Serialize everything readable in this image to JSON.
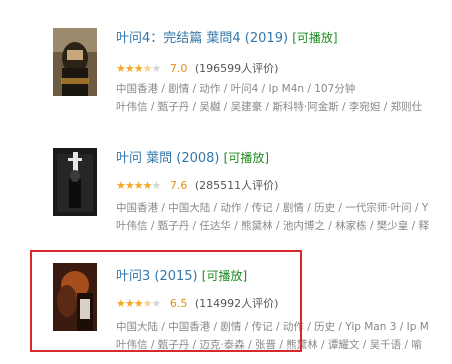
{
  "results": [
    {
      "title": "叶问4：完结篇 葉問4 (2019)",
      "playable": "[可播放]",
      "rating": 7.0,
      "rating_text": "7.0",
      "votes": "(196599人评价)",
      "meta": "中国香港 / 剧情 / 动作 / 叶问4 / Ip M4n / 107分钟",
      "cast": "叶伟信 / 甄子丹 / 吴樾 / 吴建豪 / 斯科特·阿金斯 / 李宛妲 / 郑则仕"
    },
    {
      "title": "叶问 葉問 (2008)",
      "playable": "[可播放]",
      "rating": 7.6,
      "rating_text": "7.6",
      "votes": "(285511人评价)",
      "meta": "中国香港 / 中国大陆 / 动作 / 传记 / 剧情 / 历史 / 一代宗师·叶问 / Y",
      "cast": "叶伟信 / 甄子丹 / 任达华 / 熊黛林 / 池内博之 / 林家栋 / 樊少皇 / 释"
    },
    {
      "title": "叶问3 (2015)",
      "playable": "[可播放]",
      "rating": 6.5,
      "rating_text": "6.5",
      "votes": "(114992人评价)",
      "meta": "中国大陆 / 中国香港 / 剧情 / 传记 / 动作 / 历史 / Yip Man 3 / Ip M",
      "cast": "叶伟信 / 甄子丹 / 迈克·泰森 / 张晋 / 熊黛林 / 谭耀文 / 吴千语 / 喻"
    }
  ],
  "colors": {
    "title_link": "#3377aa",
    "playable": "#1d8a20",
    "star": "#f5a623",
    "score": "#e09015",
    "highlight": "#d62b2b"
  }
}
